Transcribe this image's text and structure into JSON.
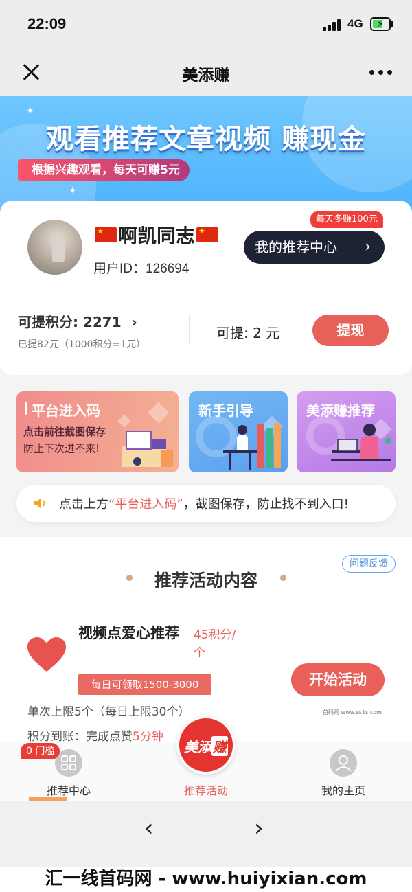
{
  "status": {
    "time": "22:09",
    "network": "4G"
  },
  "nav": {
    "title": "美添赚"
  },
  "banner": {
    "headline": "观看推荐文章视频 赚现金",
    "subtitle": "根据兴趣观看，每天可赚5元"
  },
  "profile": {
    "name": "啊凯同志",
    "user_id_label": "用户ID：126694",
    "bonus_tag": "每天多赚100元",
    "center_button": "我的推荐中心",
    "center_chevron": "›"
  },
  "points": {
    "label": "可提积分: 2271",
    "chevron": "›",
    "detail": "已提82元（1000积分=1元）",
    "available": "可提: 2 元",
    "withdraw_button": "提现"
  },
  "tiles": [
    {
      "title": "平台进入码",
      "line1": "点击前往截图保存",
      "line2": "防止下次进不来!"
    },
    {
      "title": "新手引导"
    },
    {
      "title": "美添赚推荐"
    }
  ],
  "notice": {
    "prefix": "点击上方",
    "highlight": "“平台进入码”",
    "suffix": "，截图保存，防止找不到入口!"
  },
  "section": {
    "feedback": "问题反馈",
    "title": "推荐活动内容",
    "activity": {
      "name": "视频点爱心推荐",
      "rate": "45积分/个",
      "tag": "每日可领取1500-3000",
      "start_button": "开始活动",
      "limit": "单次上限5个（每日上限30个）",
      "arrival_prefix": "积分到账：完成点赞",
      "arrival_highlight": "5分钟"
    }
  },
  "tabbar": {
    "threshold": "0 门槛",
    "tabs": [
      {
        "label": "推荐中心"
      },
      {
        "label": "推荐活动"
      },
      {
        "label": "我的主页"
      }
    ],
    "center_logo": {
      "text": "美添",
      "text2": "赚"
    }
  },
  "browser": {
    "back": "‹",
    "forward": "›"
  },
  "watermark": {
    "text": "汇一线首码网 - www.huiyixian.com",
    "small": "首码网 www.es1s.com"
  },
  "colors": {
    "accent": "#e7605a",
    "dark_button": "#1d2235",
    "banner_blue": "#4eb3fb",
    "tag_red": "#ef3e3a"
  },
  "icons": [
    "close-icon",
    "more-icon",
    "chevron-right-icon",
    "speaker-icon",
    "heart-icon",
    "grid-icon",
    "user-icon",
    "back-icon",
    "forward-icon"
  ]
}
